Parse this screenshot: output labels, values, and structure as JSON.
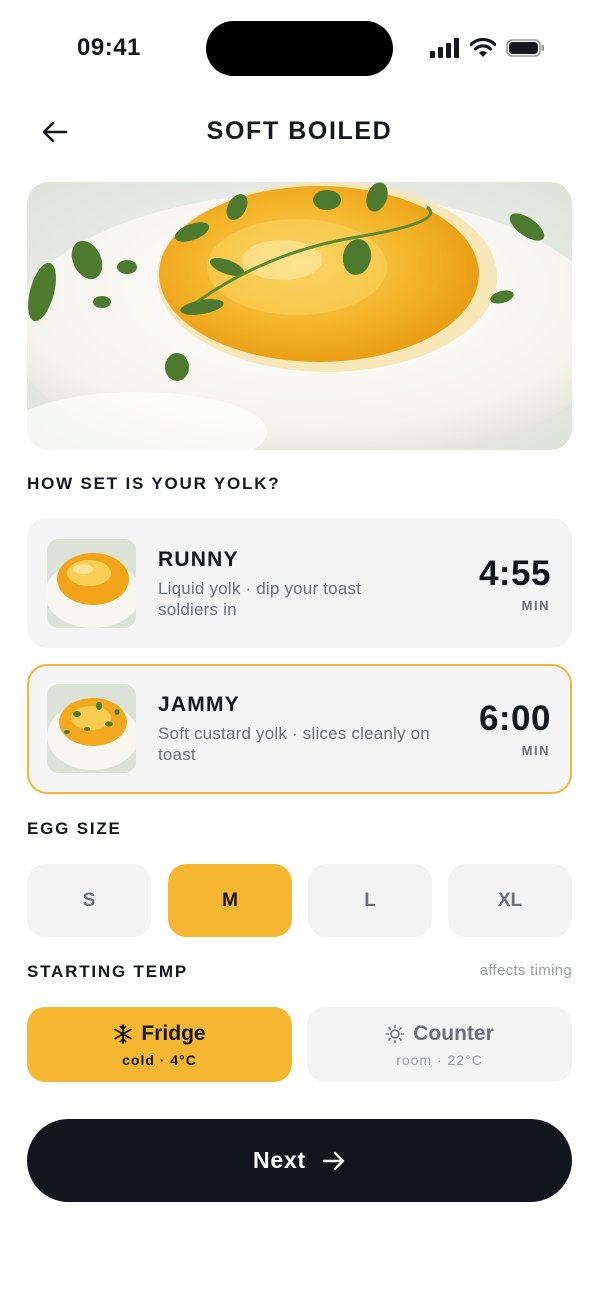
{
  "status": {
    "time": "09:41"
  },
  "header": {
    "title": "SOFT BOILED"
  },
  "yolk": {
    "label": "HOW SET IS YOUR YOLK?",
    "options": [
      {
        "name": "RUNNY",
        "desc": "Liquid yolk · dip your toast soldiers in",
        "time": "4:55",
        "unit": "MIN",
        "selected": false
      },
      {
        "name": "JAMMY",
        "desc": "Soft custard yolk · slices cleanly on toast",
        "time": "6:00",
        "unit": "MIN",
        "selected": true
      }
    ]
  },
  "size": {
    "label": "EGG SIZE",
    "options": [
      "S",
      "M",
      "L",
      "XL"
    ],
    "selected": "M"
  },
  "temp": {
    "label": "STARTING TEMP",
    "hint": "affects timing",
    "options": [
      {
        "label": "Fridge",
        "sub": "cold · 4°C",
        "icon": "snowflake-icon",
        "selected": true
      },
      {
        "label": "Counter",
        "sub": "room · 22°C",
        "icon": "sun-icon",
        "selected": false
      }
    ]
  },
  "next": {
    "label": "Next"
  },
  "colors": {
    "accent": "#f5b731",
    "dark": "#12161c",
    "muted": "#6b6f76"
  }
}
